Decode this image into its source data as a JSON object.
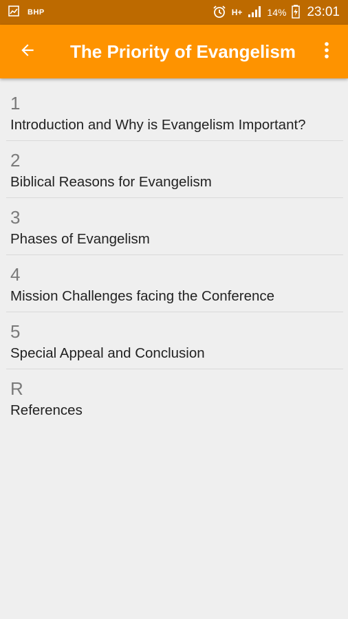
{
  "status_bar": {
    "carrier": "BHP",
    "network": "H+",
    "battery": "14%",
    "time": "23:01",
    "icons": [
      "image-icon",
      "alarm-icon",
      "signal-icon",
      "battery-charging-icon"
    ]
  },
  "app_bar": {
    "title": "The Priority of Evangelism",
    "back_icon": "arrow-back-icon",
    "menu_icon": "more-vert-icon",
    "color": "#fe9300"
  },
  "chapters": [
    {
      "number": "1",
      "title": "Introduction and Why is Evangelism Important?"
    },
    {
      "number": "2",
      "title": "Biblical Reasons for Evangelism"
    },
    {
      "number": "3",
      "title": "Phases of Evangelism"
    },
    {
      "number": "4",
      "title": "Mission Challenges facing the Conference"
    },
    {
      "number": "5",
      "title": "Special Appeal and Conclusion"
    },
    {
      "number": "R",
      "title": "References"
    }
  ]
}
